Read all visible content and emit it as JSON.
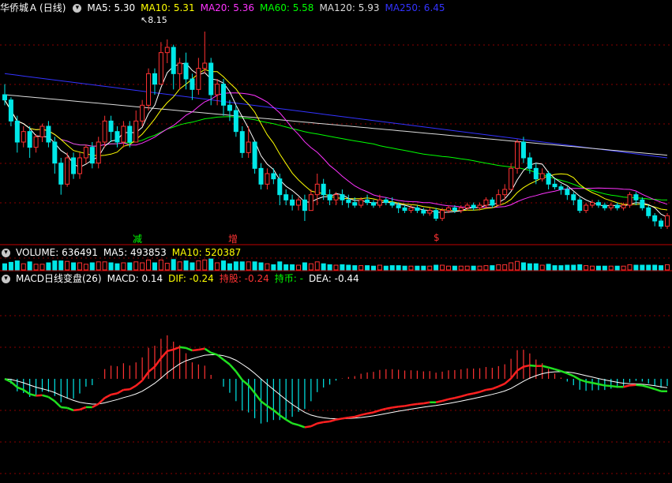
{
  "main_header": {
    "title": "华侨城Ａ",
    "period": "(日线)",
    "ma_items": [
      {
        "label": "MA5: 5.30",
        "color": "#ffffff"
      },
      {
        "label": "MA10: 5.31",
        "color": "#ffff00"
      },
      {
        "label": "MA20: 5.36",
        "color": "#ff33ff"
      },
      {
        "label": "MA60: 5.58",
        "color": "#00ff00"
      },
      {
        "label": "MA120: 5.93",
        "color": "#dcdcdc"
      },
      {
        "label": "MA250: 6.45",
        "color": "#3333ff"
      }
    ]
  },
  "price_annotation": "8.15",
  "signal_marks": [
    {
      "text": "减",
      "color": "#00ff00"
    },
    {
      "text": "增",
      "color": "#ff3333"
    },
    {
      "text": "$",
      "color": "#ff3333"
    }
  ],
  "volume_header": {
    "label": "VOLUME: 636491",
    "ma5": "MA5: 493853",
    "ma10": "MA10: 520387"
  },
  "macd_header": {
    "name": "MACD日线变盘(26)",
    "macd": "MACD: 0.14",
    "dif": "DIF: -0.24",
    "hold": "持股: -0.24",
    "cash": "持币: -",
    "dea": "DEA: -0.44"
  },
  "colors": {
    "up": "#ff3232",
    "down": "#00e8e8",
    "grid": "#8a0000",
    "ma5": "#ffffff",
    "ma10": "#ffff00",
    "ma20": "#ff33ff",
    "ma60": "#00ff00",
    "ma120": "#dcdcdc",
    "ma250": "#3333ff"
  },
  "chart_data": {
    "type": "candlestick",
    "price_range": [
      4.4,
      8.6
    ],
    "high_annotation": 8.15,
    "candles": [
      [
        7.1,
        7.0,
        7.3,
        6.9
      ],
      [
        7.0,
        6.6,
        7.05,
        6.5
      ],
      [
        6.6,
        6.2,
        6.7,
        6.0
      ],
      [
        6.2,
        6.4,
        6.5,
        6.1
      ],
      [
        6.4,
        6.1,
        6.5,
        5.9
      ],
      [
        6.1,
        6.3,
        6.35,
        6.0
      ],
      [
        6.3,
        6.5,
        6.55,
        6.2
      ],
      [
        6.5,
        6.2,
        6.6,
        6.1
      ],
      [
        6.2,
        5.8,
        6.3,
        5.6
      ],
      [
        5.8,
        5.4,
        5.9,
        5.2
      ],
      [
        5.4,
        5.9,
        6.0,
        5.35
      ],
      [
        5.9,
        5.6,
        6.0,
        5.5
      ],
      [
        5.6,
        5.9,
        6.0,
        5.5
      ],
      [
        5.9,
        6.1,
        6.15,
        5.8
      ],
      [
        6.1,
        5.8,
        6.2,
        5.7
      ],
      [
        5.8,
        6.2,
        6.3,
        5.7
      ],
      [
        6.2,
        6.6,
        6.7,
        6.1
      ],
      [
        6.6,
        6.4,
        6.7,
        6.2
      ],
      [
        6.4,
        6.2,
        6.5,
        6.1
      ],
      [
        6.2,
        6.5,
        6.6,
        6.1
      ],
      [
        6.5,
        6.2,
        6.6,
        6.1
      ],
      [
        6.2,
        6.6,
        6.8,
        6.2
      ],
      [
        6.6,
        6.9,
        7.0,
        6.5
      ],
      [
        6.9,
        7.5,
        7.6,
        6.8
      ],
      [
        7.5,
        7.3,
        7.6,
        7.1
      ],
      [
        7.3,
        7.9,
        8.1,
        7.3
      ],
      [
        7.9,
        8.0,
        8.15,
        7.7
      ],
      [
        8.0,
        7.5,
        8.05,
        7.2
      ],
      [
        7.5,
        7.7,
        7.8,
        7.2
      ],
      [
        7.7,
        7.4,
        7.9,
        7.2
      ],
      [
        7.4,
        7.2,
        7.5,
        7.0
      ],
      [
        7.2,
        7.6,
        7.8,
        7.1
      ],
      [
        7.6,
        7.7,
        8.3,
        7.5
      ],
      [
        7.7,
        7.1,
        7.8,
        6.9
      ],
      [
        7.1,
        7.3,
        7.4,
        6.9
      ],
      [
        7.3,
        6.9,
        7.4,
        6.7
      ],
      [
        6.9,
        6.8,
        7.0,
        6.6
      ],
      [
        6.8,
        6.4,
        6.9,
        6.3
      ],
      [
        6.4,
        6.0,
        6.5,
        5.9
      ],
      [
        6.0,
        6.2,
        6.5,
        5.9
      ],
      [
        6.2,
        5.7,
        6.2,
        5.6
      ],
      [
        5.7,
        5.4,
        5.8,
        5.3
      ],
      [
        5.4,
        5.6,
        5.7,
        5.3
      ],
      [
        5.6,
        5.5,
        5.7,
        5.4
      ],
      [
        5.5,
        5.2,
        5.6,
        5.0
      ],
      [
        5.2,
        5.1,
        5.3,
        5.0
      ],
      [
        5.1,
        5.0,
        5.2,
        4.9
      ],
      [
        5.0,
        5.1,
        5.15,
        4.9
      ],
      [
        5.1,
        4.9,
        5.2,
        4.7
      ],
      [
        4.9,
        5.2,
        5.3,
        4.9
      ],
      [
        5.2,
        5.4,
        5.6,
        5.0
      ],
      [
        5.4,
        5.2,
        5.5,
        5.1
      ],
      [
        5.2,
        5.1,
        5.3,
        5.0
      ],
      [
        5.1,
        5.2,
        5.25,
        5.0
      ],
      [
        5.2,
        5.1,
        5.3,
        5.0
      ],
      [
        5.1,
        5.05,
        5.2,
        4.95
      ],
      [
        5.05,
        5.0,
        5.15,
        4.95
      ],
      [
        5.0,
        5.1,
        5.15,
        4.95
      ],
      [
        5.1,
        5.05,
        5.2,
        5.0
      ],
      [
        5.05,
        5.0,
        5.1,
        4.95
      ],
      [
        5.0,
        5.1,
        5.2,
        4.95
      ],
      [
        5.1,
        5.05,
        5.15,
        5.0
      ],
      [
        5.05,
        5.0,
        5.15,
        4.95
      ],
      [
        5.0,
        4.95,
        5.05,
        4.85
      ],
      [
        4.95,
        4.9,
        5.0,
        4.85
      ],
      [
        4.9,
        4.95,
        5.0,
        4.85
      ],
      [
        4.95,
        4.9,
        5.0,
        4.85
      ],
      [
        4.9,
        4.85,
        4.95,
        4.8
      ],
      [
        4.85,
        4.9,
        4.95,
        4.8
      ],
      [
        4.9,
        4.75,
        4.95,
        4.7
      ],
      [
        4.75,
        4.9,
        4.95,
        4.7
      ],
      [
        4.9,
        4.95,
        5.0,
        4.85
      ],
      [
        4.95,
        4.9,
        5.0,
        4.85
      ],
      [
        4.9,
        4.95,
        5.0,
        4.85
      ],
      [
        4.95,
        5.0,
        5.05,
        4.9
      ],
      [
        5.0,
        4.95,
        5.05,
        4.9
      ],
      [
        4.95,
        5.0,
        5.05,
        4.9
      ],
      [
        5.0,
        5.1,
        5.15,
        4.95
      ],
      [
        5.1,
        5.0,
        5.15,
        4.95
      ],
      [
        5.0,
        5.2,
        5.3,
        5.0
      ],
      [
        5.2,
        5.3,
        5.4,
        5.1
      ],
      [
        5.3,
        5.7,
        5.8,
        5.3
      ],
      [
        5.7,
        6.2,
        6.25,
        5.6
      ],
      [
        6.2,
        5.9,
        6.3,
        5.8
      ],
      [
        5.9,
        5.7,
        6.0,
        5.6
      ],
      [
        5.7,
        5.5,
        5.8,
        5.4
      ],
      [
        5.5,
        5.6,
        5.7,
        5.45
      ],
      [
        5.6,
        5.4,
        5.65,
        5.3
      ],
      [
        5.4,
        5.35,
        5.5,
        5.3
      ],
      [
        5.35,
        5.3,
        5.4,
        5.2
      ],
      [
        5.3,
        5.2,
        5.35,
        5.1
      ],
      [
        5.2,
        5.1,
        5.25,
        5.0
      ],
      [
        5.1,
        4.9,
        5.15,
        4.85
      ],
      [
        4.9,
        5.0,
        5.05,
        4.85
      ],
      [
        5.0,
        5.05,
        5.1,
        4.95
      ],
      [
        5.05,
        5.0,
        5.1,
        4.95
      ],
      [
        5.0,
        4.95,
        5.05,
        4.9
      ],
      [
        4.95,
        5.0,
        5.05,
        4.9
      ],
      [
        5.0,
        4.95,
        5.05,
        4.9
      ],
      [
        4.95,
        5.0,
        5.05,
        4.9
      ],
      [
        5.0,
        5.2,
        5.25,
        4.95
      ],
      [
        5.2,
        5.1,
        5.25,
        5.0
      ],
      [
        5.1,
        4.95,
        5.15,
        4.9
      ],
      [
        4.95,
        4.8,
        5.0,
        4.75
      ],
      [
        4.8,
        4.7,
        4.85,
        4.6
      ],
      [
        4.7,
        4.6,
        4.75,
        4.55
      ],
      [
        4.6,
        4.8,
        4.85,
        4.55
      ]
    ],
    "ma250_range": [
      7.5,
      5.9
    ],
    "ma120_range": [
      7.1,
      5.95
    ],
    "volume": {
      "label": 636491,
      "ma5": 493853,
      "ma10": 520387
    },
    "macd": {
      "dif_last": -0.24,
      "dea_last": -0.44,
      "macd_last": 0.14,
      "y_range": [
        -0.95,
        0.95
      ]
    }
  }
}
